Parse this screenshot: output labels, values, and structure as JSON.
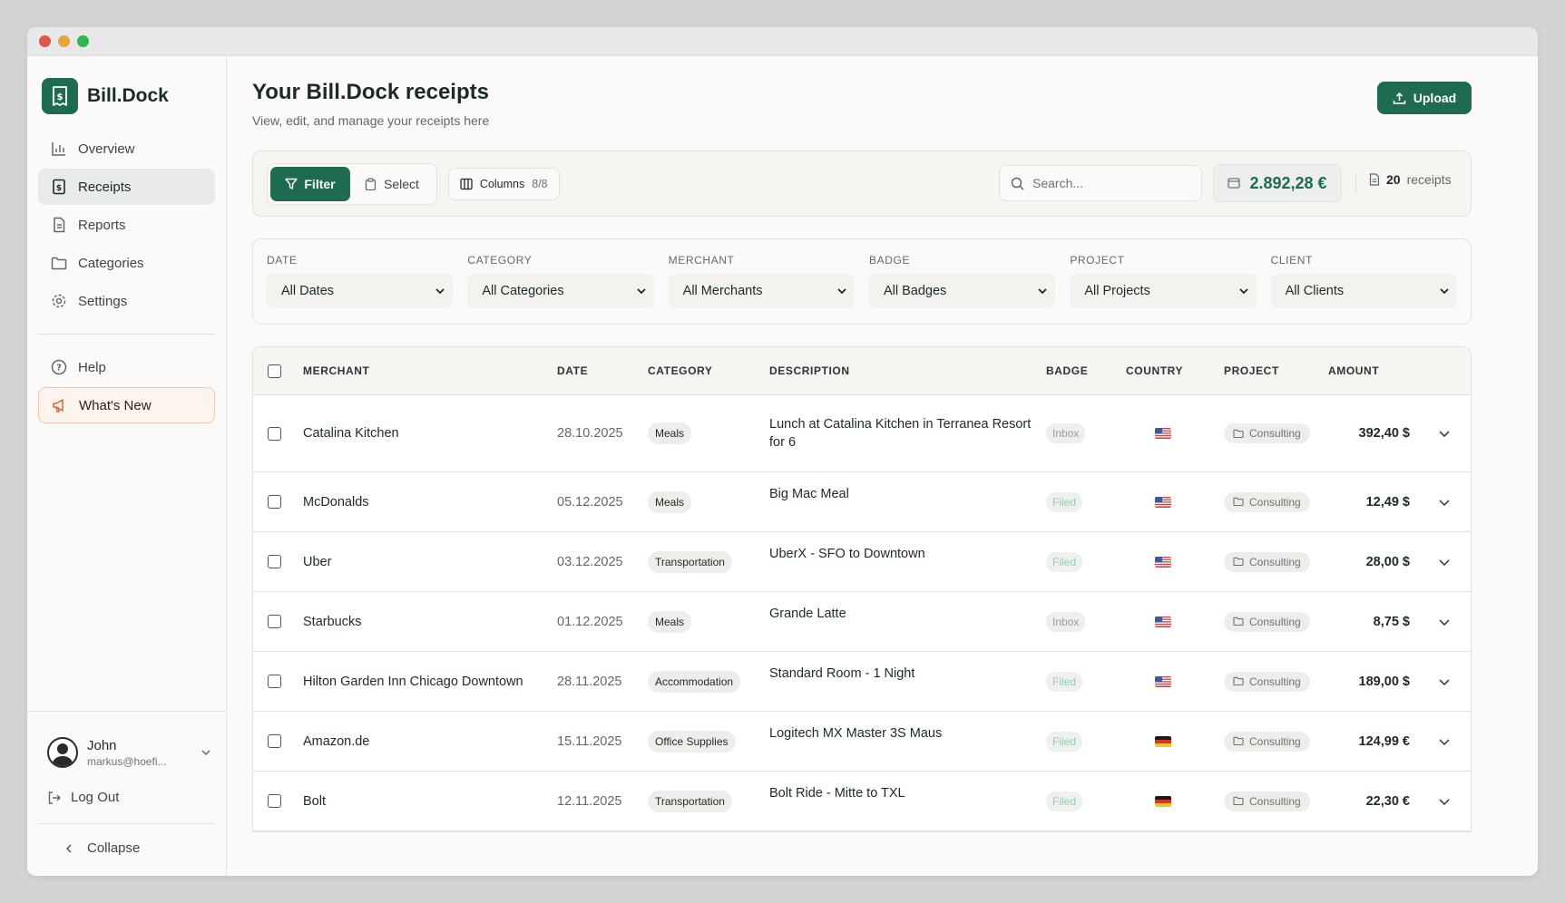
{
  "app": {
    "name": "Bill.Dock"
  },
  "nav": {
    "items": [
      {
        "label": "Overview",
        "icon": "bar-chart-icon"
      },
      {
        "label": "Receipts",
        "icon": "receipt-icon"
      },
      {
        "label": "Reports",
        "icon": "document-icon"
      },
      {
        "label": "Categories",
        "icon": "folder-icon"
      },
      {
        "label": "Settings",
        "icon": "gear-icon"
      }
    ],
    "help": "Help",
    "whats_new": "What's New"
  },
  "user": {
    "name": "John",
    "email": "markus@hoefi..."
  },
  "logout": "Log Out",
  "collapse": "Collapse",
  "header": {
    "title": "Your Bill.Dock receipts",
    "subtitle": "View, edit, and manage your receipts here",
    "upload": "Upload"
  },
  "toolbar": {
    "filter": "Filter",
    "select": "Select",
    "columns": "Columns",
    "columns_count": "8/8",
    "search_placeholder": "Search...",
    "total": "2.892,28 €",
    "receipt_count": "20",
    "receipt_label": "receipts"
  },
  "filters": [
    {
      "label": "DATE",
      "value": "All Dates"
    },
    {
      "label": "CATEGORY",
      "value": "All Categories"
    },
    {
      "label": "MERCHANT",
      "value": "All Merchants"
    },
    {
      "label": "BADGE",
      "value": "All Badges"
    },
    {
      "label": "PROJECT",
      "value": "All Projects"
    },
    {
      "label": "CLIENT",
      "value": "All Clients"
    }
  ],
  "table": {
    "headers": {
      "merchant": "MERCHANT",
      "date": "DATE",
      "category": "CATEGORY",
      "description": "DESCRIPTION",
      "badge": "BADGE",
      "country": "COUNTRY",
      "project": "PROJECT",
      "amount": "AMOUNT"
    },
    "rows": [
      {
        "merchant": "Catalina Kitchen",
        "date": "28.10.2025",
        "category": "Meals",
        "description": "Lunch at Catalina Kitchen in Terranea Resort for 6",
        "badge": "Inbox",
        "country": "us",
        "project": "Consulting",
        "amount": "392,40 $"
      },
      {
        "merchant": "McDonalds",
        "date": "05.12.2025",
        "category": "Meals",
        "description": "Big Mac Meal",
        "badge": "Filed",
        "country": "us",
        "project": "Consulting",
        "amount": "12,49 $"
      },
      {
        "merchant": "Uber",
        "date": "03.12.2025",
        "category": "Transportation",
        "description": "UberX - SFO to Downtown",
        "badge": "Filed",
        "country": "us",
        "project": "Consulting",
        "amount": "28,00 $"
      },
      {
        "merchant": "Starbucks",
        "date": "01.12.2025",
        "category": "Meals",
        "description": "Grande Latte",
        "badge": "Inbox",
        "country": "us",
        "project": "Consulting",
        "amount": "8,75 $"
      },
      {
        "merchant": "Hilton Garden Inn Chicago Downtown",
        "date": "28.11.2025",
        "category": "Accommodation",
        "description": "Standard Room - 1 Night",
        "badge": "Filed",
        "country": "us",
        "project": "Consulting",
        "amount": "189,00 $"
      },
      {
        "merchant": "Amazon.de",
        "date": "15.11.2025",
        "category": "Office Supplies",
        "description": "Logitech MX Master 3S Maus",
        "badge": "Filed",
        "country": "de",
        "project": "Consulting",
        "amount": "124,99 €"
      },
      {
        "merchant": "Bolt",
        "date": "12.11.2025",
        "category": "Transportation",
        "description": "Bolt Ride - Mitte to TXL",
        "badge": "Filed",
        "country": "de",
        "project": "Consulting",
        "amount": "22,30 €"
      }
    ]
  },
  "colors": {
    "brand": "#1f6b4f",
    "filed": "#8fcfae",
    "inbox": "#9a9e9c"
  }
}
